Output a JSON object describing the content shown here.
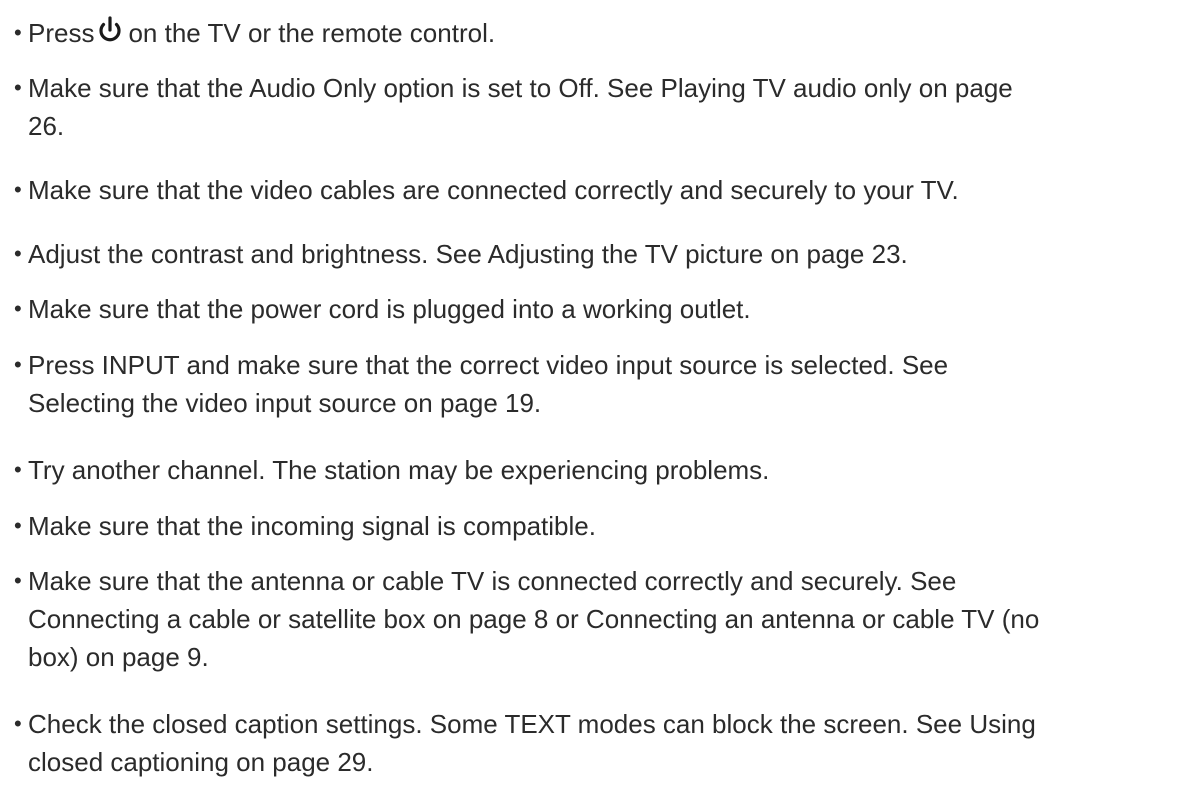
{
  "icons": {
    "power": "power-icon"
  },
  "items": [
    {
      "before_icon": "Press",
      "after_icon": "on the TV or the remote control."
    },
    {
      "lines": [
        "Make sure that the Audio Only option is set to Off. See Playing TV audio only on page",
        "26."
      ]
    },
    {
      "lines": [
        "Make sure that the video cables are connected correctly and securely to your TV."
      ]
    },
    {
      "lines": [
        "Adjust the contrast and brightness. See Adjusting the TV picture on page 23."
      ]
    },
    {
      "lines": [
        "Make sure that the power cord is plugged into a working outlet."
      ]
    },
    {
      "lines": [
        "Press INPUT and make sure that the correct video input source is selected. See",
        "Selecting the video input source on page 19."
      ]
    },
    {
      "lines": [
        "Try another channel. The station may be experiencing problems."
      ]
    },
    {
      "lines": [
        "Make sure that the incoming signal is compatible."
      ]
    },
    {
      "lines": [
        "Make sure that the antenna or cable TV is connected correctly and securely. See",
        "Connecting a cable or satellite box on page 8 or Connecting an antenna or cable TV (no",
        "box) on page 9."
      ]
    },
    {
      "lines": [
        "Check the closed caption settings. Some TEXT modes can block the screen. See Using",
        "closed captioning on page 29."
      ]
    }
  ]
}
